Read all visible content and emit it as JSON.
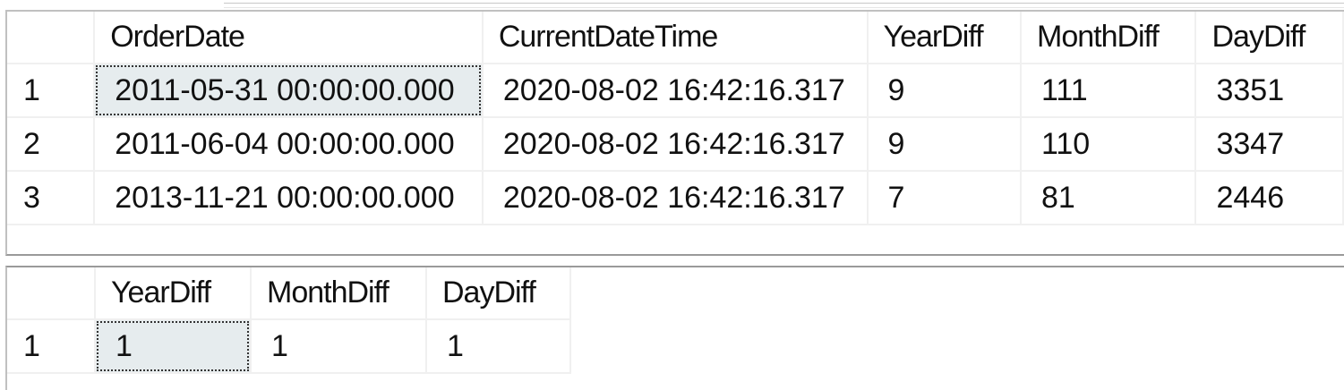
{
  "result1": {
    "columns": [
      "OrderDate",
      "CurrentDateTime",
      "YearDiff",
      "MonthDiff",
      "DayDiff"
    ],
    "rows": [
      {
        "num": "1",
        "OrderDate": "2011-05-31 00:00:00.000",
        "CurrentDateTime": "2020-08-02 16:42:16.317",
        "YearDiff": "9",
        "MonthDiff": "111",
        "DayDiff": "3351"
      },
      {
        "num": "2",
        "OrderDate": "2011-06-04 00:00:00.000",
        "CurrentDateTime": "2020-08-02 16:42:16.317",
        "YearDiff": "9",
        "MonthDiff": "110",
        "DayDiff": "3347"
      },
      {
        "num": "3",
        "OrderDate": "2013-11-21 00:00:00.000",
        "CurrentDateTime": "2020-08-02 16:42:16.317",
        "YearDiff": "7",
        "MonthDiff": "81",
        "DayDiff": "2446"
      }
    ]
  },
  "result2": {
    "columns": [
      "YearDiff",
      "MonthDiff",
      "DayDiff"
    ],
    "rows": [
      {
        "num": "1",
        "YearDiff": "1",
        "MonthDiff": "1",
        "DayDiff": "1"
      }
    ]
  },
  "colors": {
    "selected_cell_bg": "#e6ecee",
    "grid_line": "#f0f0f0",
    "panel_border": "#c0c0c0"
  }
}
